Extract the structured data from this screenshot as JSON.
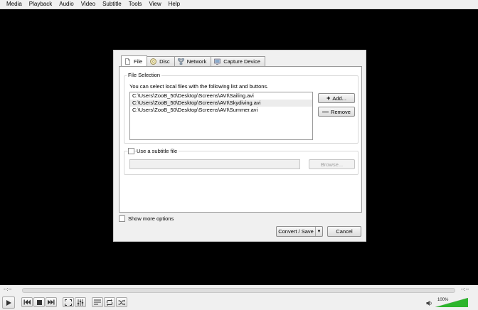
{
  "menu": [
    "Media",
    "Playback",
    "Audio",
    "Video",
    "Subtitle",
    "Tools",
    "View",
    "Help"
  ],
  "dialog": {
    "tabs": [
      {
        "label": "File",
        "icon": "file-icon",
        "active": true
      },
      {
        "label": "Disc",
        "icon": "disc-icon",
        "active": false
      },
      {
        "label": "Network",
        "icon": "network-icon",
        "active": false
      },
      {
        "label": "Capture Device",
        "icon": "capture-device-icon",
        "active": false
      }
    ],
    "file_selection": {
      "title": "File Selection",
      "description": "You can select local files with the following list and buttons.",
      "files": [
        "C:\\Users\\ZooB_50\\Desktop\\Screens\\AVI\\Sailing.avi",
        "C:\\Users\\ZooB_50\\Desktop\\Screens\\AVI\\Skydiving.avi",
        "C:\\Users\\ZooB_50\\Desktop\\Screens\\AVI\\Summer.avi"
      ],
      "add_label": "Add...",
      "remove_label": "Remove"
    },
    "subtitle": {
      "checkbox_label": "Use a subtitle file",
      "checked": false,
      "path_value": "",
      "browse_label": "Browse..."
    },
    "show_more_label": "Show more options",
    "convert_label": "Convert / Save",
    "cancel_label": "Cancel"
  },
  "player": {
    "elapsed": "--:--",
    "total": "--:--",
    "volume": "100%",
    "volume_level": 1.0,
    "accent": "#2db52d"
  }
}
